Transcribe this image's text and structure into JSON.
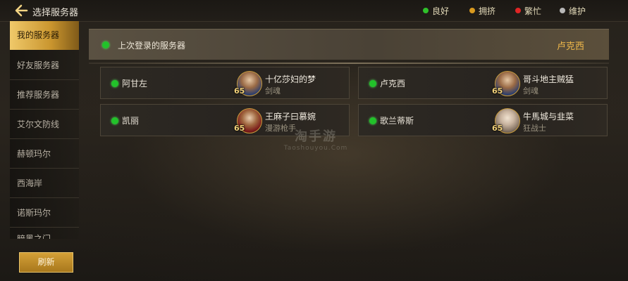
{
  "header": {
    "title": "选择服务器",
    "legend": [
      {
        "label": "良好",
        "color": "#2fc02a",
        "text_color": "#e2d9b8"
      },
      {
        "label": "拥挤",
        "color": "#d99a1f",
        "text_color": "#e2d9b8"
      },
      {
        "label": "繁忙",
        "color": "#e02525",
        "text_color": "#e2d9b8"
      },
      {
        "label": "维护",
        "color": "#b8b8b8",
        "text_color": "#e2d9b8"
      }
    ]
  },
  "sidebar": {
    "items": [
      {
        "label": "我的服务器"
      },
      {
        "label": "好友服务器"
      },
      {
        "label": "推荐服务器"
      },
      {
        "label": "艾尔文防线"
      },
      {
        "label": "赫顿玛尔"
      },
      {
        "label": "西海岸"
      },
      {
        "label": "诺斯玛尔"
      },
      {
        "label": "暗黑之门"
      }
    ],
    "refresh_label": "刷新"
  },
  "last_login": {
    "label": "上次登录的服务器",
    "server": "卢克西",
    "accent": "#f0b84a"
  },
  "servers": [
    {
      "name": "阿甘左",
      "character": "十亿莎妇的梦",
      "class": "剑魂",
      "level": "65"
    },
    {
      "name": "卢克西",
      "character": "哥斗地主贼猛",
      "class": "剑魂",
      "level": "65"
    },
    {
      "name": "凯丽",
      "character": "王麻子曰慕婉",
      "class": "漫游枪手",
      "level": "65"
    },
    {
      "name": "歌兰蒂斯",
      "character": "牛馬城与韭菜",
      "class": "狂战士",
      "level": "65"
    }
  ],
  "watermark": {
    "text": "淘手游",
    "sub": "Taoshouyou.Com"
  }
}
